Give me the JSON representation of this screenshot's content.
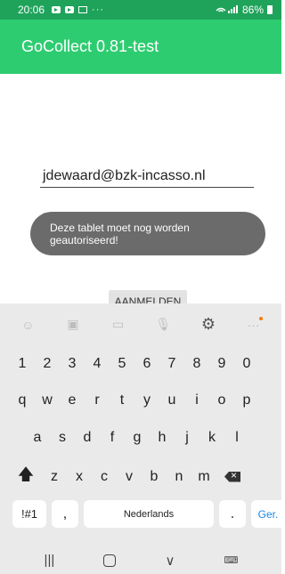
{
  "status_bar": {
    "time": "20:06",
    "overflow": "···",
    "signal": "☰•∥",
    "battery_percent": "86%"
  },
  "app_bar": {
    "title": "GoCollect 0.81-test"
  },
  "form": {
    "email_value": "jdewaard@bzk-incasso.nl",
    "password_mask": "••••••••",
    "login_label": "AANMELDEN"
  },
  "toast": {
    "message": "Deze tablet moet nog worden geautoriseerd!"
  },
  "keyboard": {
    "toolbar": [
      "emoji-icon",
      "sticker-icon",
      "gif-icon",
      "mic-icon",
      "gear-icon",
      "more-icon"
    ],
    "row1": [
      "1",
      "2",
      "3",
      "4",
      "5",
      "6",
      "7",
      "8",
      "9",
      "0"
    ],
    "row2": [
      "q",
      "w",
      "e",
      "r",
      "t",
      "y",
      "u",
      "i",
      "o",
      "p"
    ],
    "row3": [
      "a",
      "s",
      "d",
      "f",
      "g",
      "h",
      "j",
      "k",
      "l"
    ],
    "row4": [
      "z",
      "x",
      "c",
      "v",
      "b",
      "n",
      "m"
    ],
    "symbols_label": "!#1",
    "comma_label": ",",
    "space_label": "Nederlands",
    "period_label": ".",
    "go_label": "Ger."
  },
  "nav_bar": {
    "recents": "|||",
    "back": "∨",
    "keyboard": "⌨"
  },
  "colors": {
    "status_bar": "#1fa35b",
    "app_bar": "#2ecc71",
    "toast": "#6b6b6b",
    "go_key": "#1e88e5"
  }
}
